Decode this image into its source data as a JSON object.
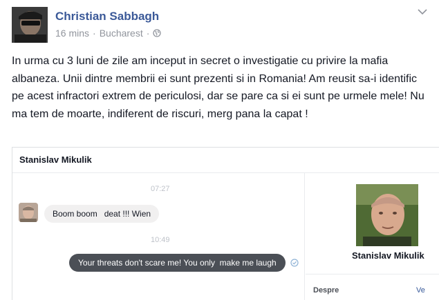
{
  "post": {
    "author": "Christian Sabbagh",
    "time": "16 mins",
    "separator": "·",
    "location": "Bucharest",
    "separator2": "·",
    "text": "In urma cu 3 luni de zile am inceput in secret o investigatie cu privire la mafia albaneza. Unii dintre membrii ei sunt prezenti si in Romania! Am reusit sa-i identific pe acest infractori extrem de periculosi, dar se pare ca si ei sunt pe urmele mele! Nu ma tem de moarte, indiferent de riscuri, merg pana la capat !"
  },
  "screenshot": {
    "header_name": "Stanislav Mikulik",
    "time1": "07:27",
    "message_in": "Boom boom   deat !!! Wien",
    "time2": "10:49",
    "message_out": "Your threats don't scare me! You only  make me laugh",
    "profile_name": "Stanislav Mikulik",
    "despre": "Despre",
    "ve": "Ve"
  },
  "colors": {
    "link_blue": "#3b5998",
    "meta_gray": "#90949c",
    "bubble_dark": "#4b4f56",
    "bubble_light": "#f1f0f0"
  }
}
